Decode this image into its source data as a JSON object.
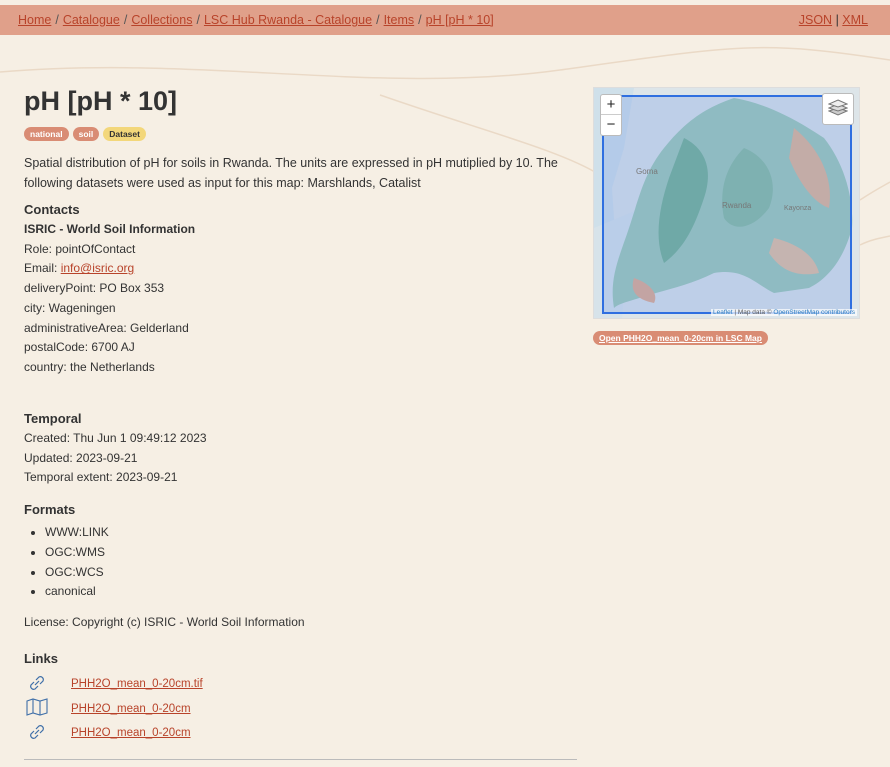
{
  "breadcrumb": {
    "items": [
      "Home",
      "Catalogue",
      "Collections",
      "LSC Hub Rwanda - Catalogue",
      "Items",
      "pH [pH * 10]"
    ],
    "separator": "/"
  },
  "formats_links": {
    "json": "JSON",
    "sep": "|",
    "xml": "XML"
  },
  "page": {
    "title": "pH [pH * 10]",
    "keywords": [
      "national",
      "soil"
    ],
    "type_badge": "Dataset",
    "description": "Spatial distribution of pH for soils in Rwanda. The units are expressed in pH mutiplied by 10. The following datasets were used as input for this map: Marshlands, Catalist"
  },
  "contacts": {
    "heading": "Contacts",
    "org": "ISRIC - World Soil Information",
    "role": "Role: pointOfContact",
    "email_label": "Email: ",
    "email": "info@isric.org",
    "delivery": "deliveryPoint: PO Box 353",
    "city": "city: Wageningen",
    "area": "administrativeArea: Gelderland",
    "postal": "postalCode: 6700 AJ",
    "country": "country: the Netherlands"
  },
  "temporal": {
    "heading": "Temporal",
    "created": "Created: Thu Jun 1 09:49:12 2023",
    "updated": "Updated: 2023-09-21",
    "extent": "Temporal extent: 2023-09-21"
  },
  "formats": {
    "heading": "Formats",
    "items": [
      "WWW:LINK",
      "OGC:WMS",
      "OGC:WCS",
      "canonical"
    ]
  },
  "license": "License: Copyright (c) ISRIC - World Soil Information",
  "links": {
    "heading": "Links",
    "items": [
      {
        "label": "PHH2O_mean_0-20cm.tif",
        "icon": "link-icon"
      },
      {
        "label": "PHH2O_mean_0-20cm",
        "icon": "map-icon"
      },
      {
        "label": "PHH2O_mean_0-20cm",
        "icon": "link-icon"
      }
    ]
  },
  "map": {
    "zoom_in": "+",
    "zoom_out": "−",
    "attribution_leaflet": "Leaflet",
    "attribution_text": " | Map data © ",
    "attribution_osm": "OpenStreetMap contributors",
    "labels": [
      "Goma",
      "Rwanda",
      "Kayonza"
    ],
    "open_button": "Open PHH2O_mean_0-20cm in LSC Map"
  },
  "colors": {
    "topbar": "#e0a08a",
    "link": "#b8432a",
    "badge_keyword": "#d98c74",
    "badge_type": "#f3d77a",
    "background": "#f6efe4"
  }
}
